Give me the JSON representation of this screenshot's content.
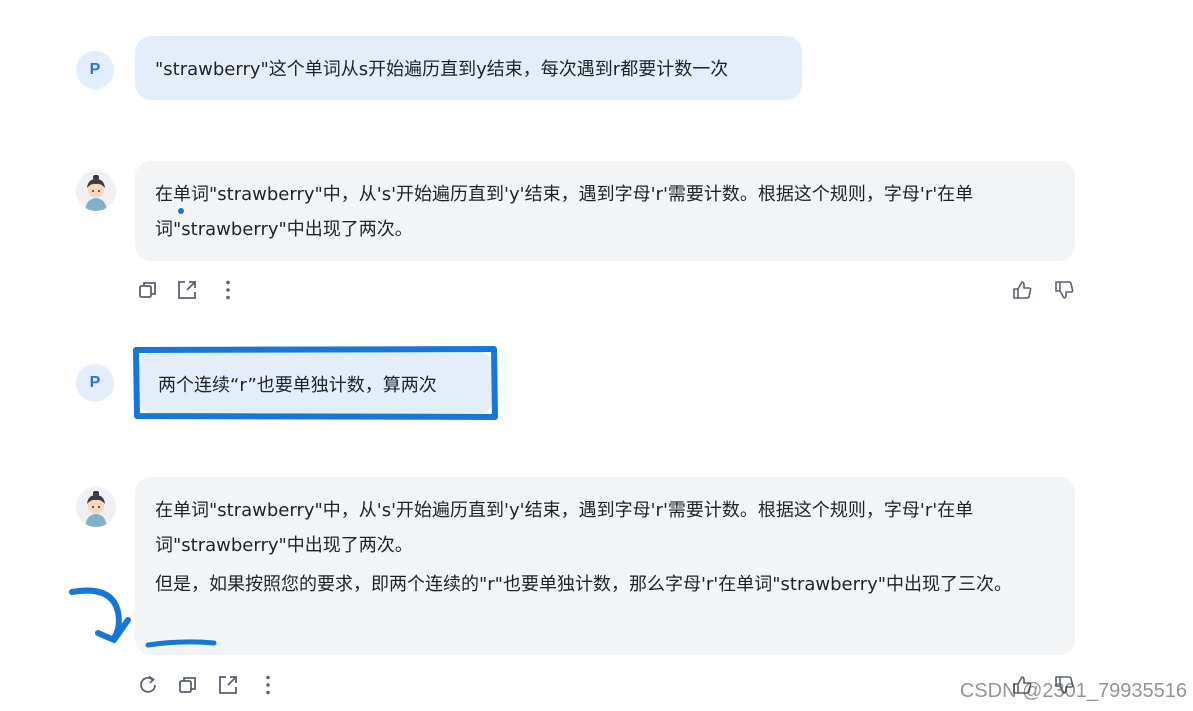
{
  "conversation": [
    {
      "role": "user",
      "avatar_letter": "P",
      "text": "\"strawberry\"这个单词从s开始遍历直到y结束，每次遇到r都要计数一次"
    },
    {
      "role": "assistant",
      "paragraphs": [
        "在单词\"strawberry\"中，从's'开始遍历直到'y'结束，遇到字母'r'需要计数。根据这个规则，字母'r'在单词\"strawberry\"中出现了两次。"
      ]
    },
    {
      "role": "user",
      "avatar_letter": "P",
      "text": "两个连续“r”也要单独计数，算两次"
    },
    {
      "role": "assistant",
      "paragraphs": [
        "在单词\"strawberry\"中，从's'开始遍历直到'y'结束，遇到字母'r'需要计数。根据这个规则，字母'r'在单词\"strawberry\"中出现了两次。",
        "但是，如果按照您的要求，即两个连续的\"r\"也要单独计数，那么字母'r'在单词\"strawberry\"中出现了三次。"
      ]
    }
  ],
  "icons": {
    "copy": "copy-icon",
    "share": "share-icon",
    "more": "more-vertical-icon",
    "like": "thumbs-up-icon",
    "dislike": "thumbs-down-icon",
    "regenerate": "regenerate-icon"
  },
  "colors": {
    "user_bubble": "#e4eefb",
    "bot_bubble": "#f3f4f6",
    "annotation_blue": "#1677d9",
    "avatar_letter": "#2f6ee0"
  },
  "watermark": "CSDN @2301_79935516"
}
